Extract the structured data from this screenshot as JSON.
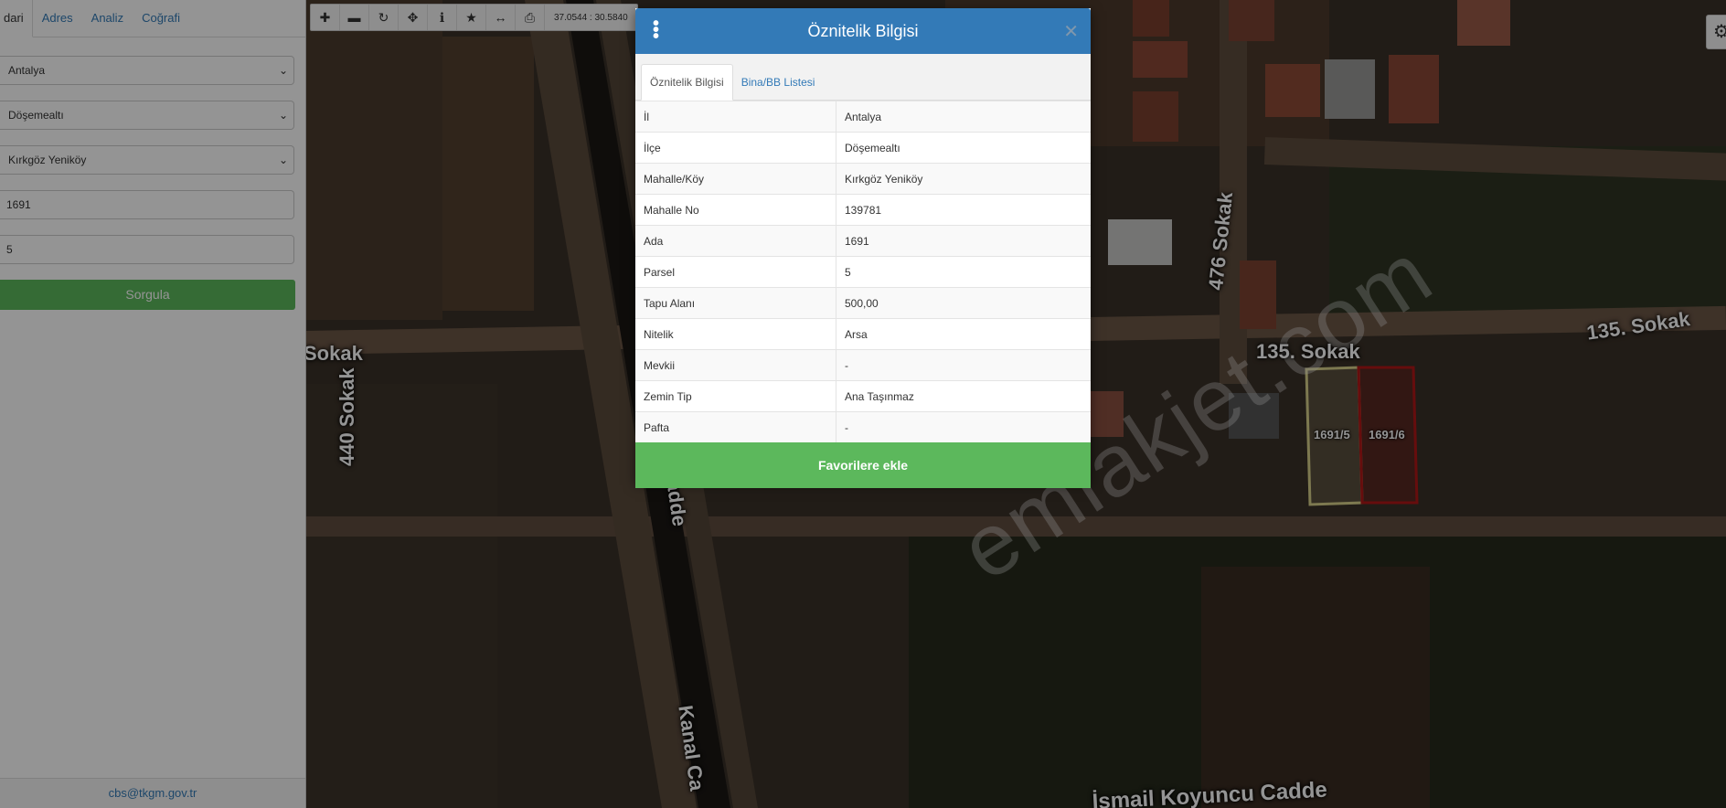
{
  "sidebar": {
    "tabs": [
      {
        "label": "dari",
        "active": true
      },
      {
        "label": "Adres",
        "active": false
      },
      {
        "label": "Analiz",
        "active": false
      },
      {
        "label": "Coğrafi",
        "active": false
      }
    ],
    "il_select": "Antalya",
    "ilce_select": "Döşemealtı",
    "mahalle_select": "Kırkgöz Yeniköy",
    "ada_input": "1691",
    "parsel_input": "5",
    "query_button": "Sorgula",
    "footer_email": "cbs@tkgm.gov.tr"
  },
  "toolbar": {
    "icons": [
      "zoom-in-icon",
      "zoom-out-icon",
      "refresh-icon",
      "move-icon",
      "info-icon",
      "star-icon",
      "measure-icon",
      "print-icon"
    ],
    "coordinates": "37.0544 : 30.5840"
  },
  "map": {
    "street_labels": {
      "sokak_440_left": "Sokak",
      "sokak_440": "440 Sokak",
      "sokak_476": "476 Sokak",
      "sokak_135_a": "135. Sokak",
      "sokak_135_b": "135. Sokak",
      "cadde_bottom": "İsmail Koyuncu Cadde",
      "kanal_cadde": "Kanal Ca",
      "cadde_center": "adde"
    },
    "parcels": [
      {
        "label": "1691/5",
        "color": "#c8c27a"
      },
      {
        "label": "1691/6",
        "color": "#b01818"
      }
    ],
    "watermark": "emlakjet.com"
  },
  "modal": {
    "title": "Öznitelik Bilgisi",
    "tabs": [
      {
        "label": "Öznitelik Bilgisi",
        "active": true
      },
      {
        "label": "Bina/BB Listesi",
        "active": false
      }
    ],
    "rows": [
      {
        "key": "İl",
        "value": "Antalya"
      },
      {
        "key": "İlçe",
        "value": "Döşemealtı"
      },
      {
        "key": "Mahalle/Köy",
        "value": "Kırkgöz Yeniköy"
      },
      {
        "key": "Mahalle No",
        "value": "139781"
      },
      {
        "key": "Ada",
        "value": "1691"
      },
      {
        "key": "Parsel",
        "value": "5"
      },
      {
        "key": "Tapu Alanı",
        "value": "500,00"
      },
      {
        "key": "Nitelik",
        "value": "Arsa"
      },
      {
        "key": "Mevkii",
        "value": "-"
      },
      {
        "key": "Zemin Tip",
        "value": "Ana Taşınmaz"
      },
      {
        "key": "Pafta",
        "value": "-"
      }
    ],
    "favorite_button": "Favorilere ekle",
    "primary_color": "#337ab7",
    "success_color": "#5cb85c"
  }
}
